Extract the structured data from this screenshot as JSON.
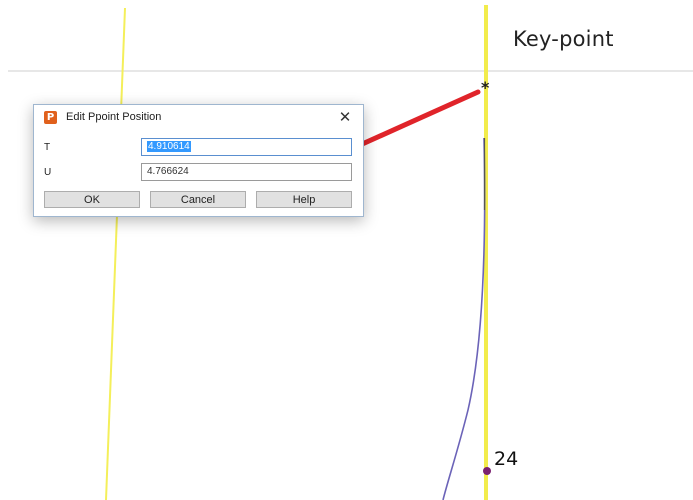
{
  "canvas": {
    "keypoint_label": "Key-point",
    "asterisk": "*",
    "point_number": "24"
  },
  "dialog": {
    "title": "Edit Ppoint Position",
    "app_icon_letter": "P",
    "close_glyph": "✕",
    "fields": [
      {
        "label": "T",
        "value": "4.910614",
        "selected": true
      },
      {
        "label": "U",
        "value": "4.766624",
        "selected": false
      }
    ],
    "buttons": {
      "ok": "OK",
      "cancel": "Cancel",
      "help": "Help"
    }
  },
  "colors": {
    "guide_line": "#f4ef5a",
    "curve": "#6b63b8",
    "arrow": "#e0242a",
    "point": "#7a2070",
    "selection": "#3399ff"
  }
}
